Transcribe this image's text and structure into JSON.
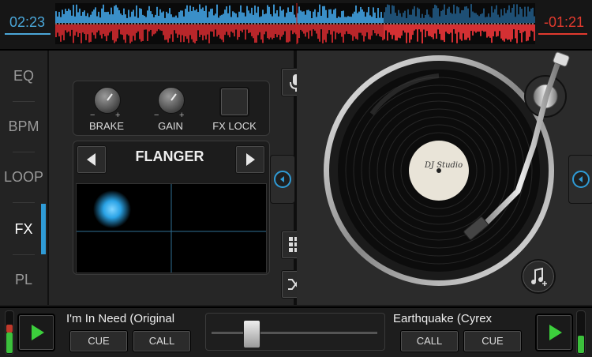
{
  "header": {
    "elapsed_time": "02:23",
    "remaining_time": "-01:21",
    "colors": {
      "left_deck": "#4aa6d8",
      "right_deck": "#e03a2e"
    }
  },
  "side_tabs": [
    {
      "label": "EQ",
      "active": false
    },
    {
      "label": "BPM",
      "active": false
    },
    {
      "label": "LOOP",
      "active": false
    },
    {
      "label": "FX",
      "active": true
    },
    {
      "label": "PL",
      "active": false
    }
  ],
  "fx_panel": {
    "knobs": [
      {
        "label": "BRAKE",
        "icon": "knob-icon"
      },
      {
        "label": "GAIN",
        "icon": "knob-icon"
      }
    ],
    "fx_lock_label": "FX LOCK",
    "effect_name": "FLANGER",
    "icons": {
      "prev": "triangle-left-icon",
      "next": "triangle-right-icon"
    }
  },
  "center_controls": {
    "icons": [
      "microphone-icon",
      "grid-icon",
      "shuffle-icon"
    ]
  },
  "deck": {
    "record_label": "DJ Studio",
    "icons": [
      "music-note-plus-icon"
    ]
  },
  "bottom_bar": {
    "left_track": "I'm In Need (Original",
    "right_track": "Earthquake (Cyrex",
    "left_buttons": {
      "cue": "CUE",
      "call": "CALL"
    },
    "right_buttons": {
      "call": "CALL",
      "cue": "CUE"
    },
    "crossfader_position": 0.2,
    "play_color": "#3ccf3c"
  }
}
